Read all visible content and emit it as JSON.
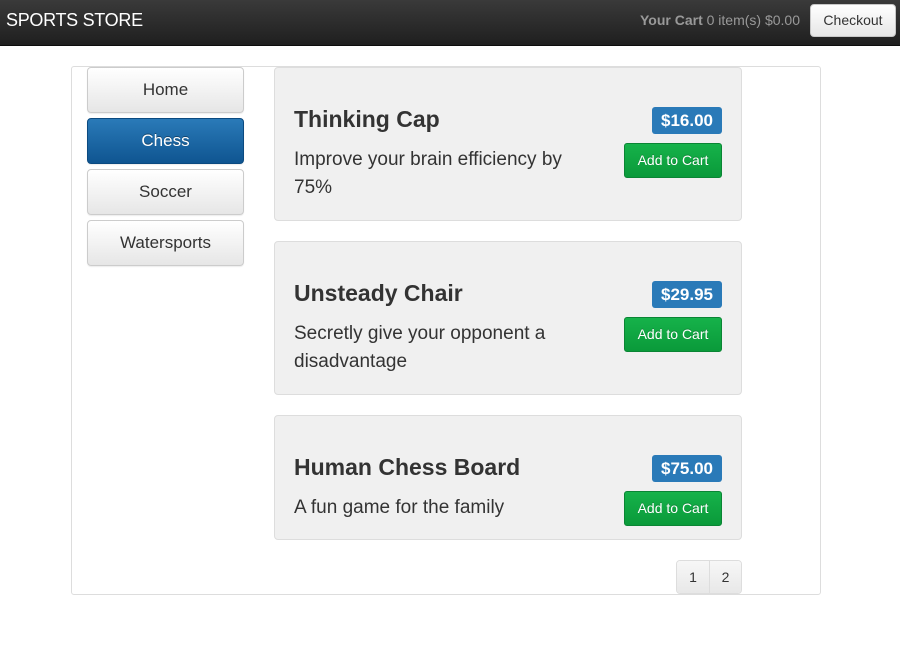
{
  "navbar": {
    "brand": "SPORTS STORE",
    "cart_label": "Your Cart",
    "cart_status": "0 item(s) $0.00",
    "checkout_label": "Checkout"
  },
  "categories": [
    {
      "label": "Home",
      "active": false
    },
    {
      "label": "Chess",
      "active": true
    },
    {
      "label": "Soccer",
      "active": false
    },
    {
      "label": "Watersports",
      "active": false
    }
  ],
  "products": [
    {
      "name": "Thinking Cap",
      "description": "Improve your brain efficiency by 75%",
      "price": "$16.00",
      "button_label": "Add to Cart"
    },
    {
      "name": "Unsteady Chair",
      "description": "Secretly give your opponent a disadvantage",
      "price": "$29.95",
      "button_label": "Add to Cart"
    },
    {
      "name": "Human Chess Board",
      "description": "A fun game for the family",
      "price": "$75.00",
      "button_label": "Add to Cart"
    }
  ],
  "pagination": {
    "pages": [
      "1",
      "2"
    ]
  },
  "colors": {
    "navbar": "#1f1f1f",
    "active_category": "#2a7ab8",
    "price_badge": "#2a7ab8",
    "add_button": "#0a9a3a"
  }
}
